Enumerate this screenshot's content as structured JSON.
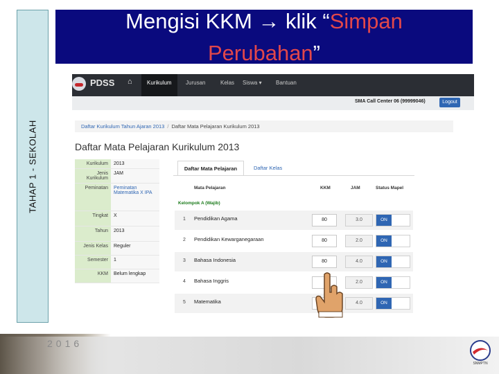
{
  "side_label": "TAHAP 1 - SEKOLAH",
  "title": {
    "line1_a": "Mengisi KKM ",
    "arrow": "→",
    "line1_b": " klik “",
    "highlight_1": "Simpan",
    "highlight_2": "Perubahan",
    "close_quote": "”"
  },
  "app": {
    "brand": "PDSS",
    "nav": [
      "Kurikulum",
      "Jurusan",
      "Kelas",
      "Siswa ▾",
      "Bantuan"
    ],
    "active_nav": "Kurikulum",
    "call_center": "SMA Call Center 06 (99999046)",
    "logout": "Logout"
  },
  "breadcrumb": [
    "Daftar Kurikulum Tahun Ajaran 2013",
    "Daftar Mata Pelajaran Kurikulum 2013"
  ],
  "page_title": "Daftar Mata Pelajaran Kurikulum 2013",
  "info": [
    {
      "key": "Kurikulum",
      "value": "2013"
    },
    {
      "key": "Jenis Kurikulum",
      "value": "JAM"
    },
    {
      "key": "Peminatan",
      "value": "Peminatan Matematika X IPA"
    },
    {
      "key": "Tingkat",
      "value": "X"
    },
    {
      "key": "Tahun",
      "value": "2013"
    },
    {
      "key": "Jenis Kelas",
      "value": "Reguler"
    },
    {
      "key": "Semester",
      "value": "1"
    },
    {
      "key": "KKM",
      "value": "Belum lengkap"
    }
  ],
  "tabs": {
    "active": "Daftar Mata Pelajaran",
    "other": "Daftar Kelas"
  },
  "columns": {
    "subject": "Mata Pelajaran",
    "kkm": "KKM",
    "jam": "JAM",
    "status": "Status Mapel"
  },
  "group": "Kelompok A (Wajib)",
  "rows": [
    {
      "no": "1",
      "name": "Pendidikan Agama",
      "kkm": "80",
      "jam": "3.0",
      "status": "ON"
    },
    {
      "no": "2",
      "name": "Pendidikan Kewarganegaraan",
      "kkm": "80",
      "jam": "2.0",
      "status": "ON"
    },
    {
      "no": "3",
      "name": "Bahasa Indonesia",
      "kkm": "80",
      "jam": "4.0",
      "status": "ON"
    },
    {
      "no": "4",
      "name": "Bahasa Inggris",
      "kkm": "",
      "jam": "2.0",
      "status": "ON"
    },
    {
      "no": "5",
      "name": "Matematika",
      "kkm": "",
      "jam": "4.0",
      "status": "ON"
    }
  ],
  "footer": {
    "year": "2016",
    "logo_text": "SNMPTN"
  },
  "colors": {
    "banner": "#0a0a7e",
    "title_highlight": "#e2474a",
    "side_band": "#cde6ea",
    "navbar": "#2b2e34",
    "on_button": "#2f66b3",
    "group_green": "#1a7a1a"
  },
  "icons": {
    "home": "home-icon",
    "pointer": "pointing-hand-icon",
    "logo": "pdss-logo-icon"
  }
}
